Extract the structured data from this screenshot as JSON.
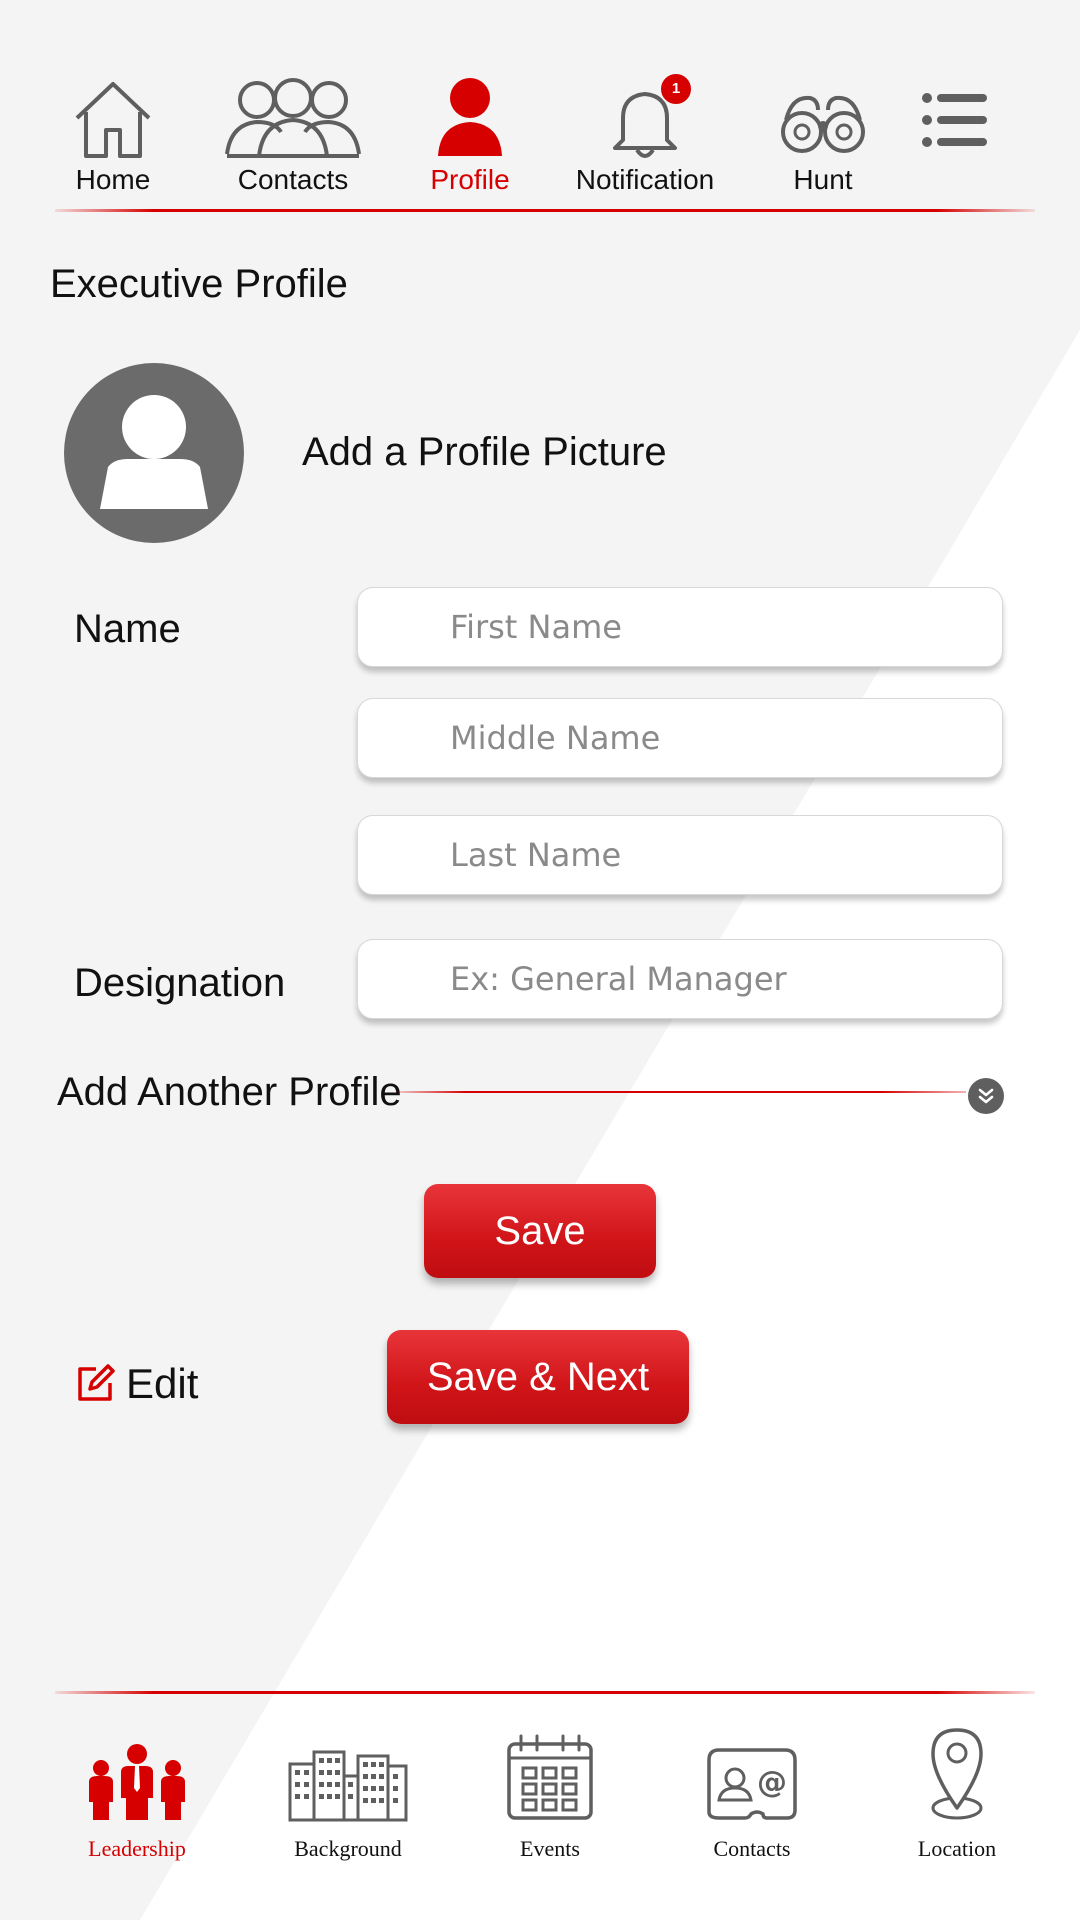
{
  "top_nav": {
    "items": [
      {
        "label": "Home",
        "icon": "home-icon"
      },
      {
        "label": "Contacts",
        "icon": "contacts-icon"
      },
      {
        "label": "Profile",
        "icon": "profile-icon",
        "active": true
      },
      {
        "label": "Notification",
        "icon": "bell-icon",
        "badge": "1"
      },
      {
        "label": "Hunt",
        "icon": "binoculars-icon"
      },
      {
        "label": "",
        "icon": "menu-icon"
      }
    ]
  },
  "page": {
    "title": "Executive Profile",
    "add_picture_label": "Add a Profile Picture"
  },
  "form": {
    "name_label": "Name",
    "first_name_placeholder": "First Name",
    "middle_name_placeholder": "Middle Name",
    "last_name_placeholder": "Last Name",
    "designation_label": "Designation",
    "designation_placeholder": "Ex: General Manager",
    "add_another_label": "Add Another Profile"
  },
  "actions": {
    "save_label": "Save",
    "save_next_label": "Save & Next",
    "edit_label": "Edit"
  },
  "bottom_nav": {
    "items": [
      {
        "label": "Leadership",
        "icon": "leadership-icon",
        "active": true
      },
      {
        "label": "Background",
        "icon": "buildings-icon"
      },
      {
        "label": "Events",
        "icon": "calendar-icon"
      },
      {
        "label": "Contacts",
        "icon": "contact-card-icon"
      },
      {
        "label": "Location",
        "icon": "location-pin-icon"
      }
    ]
  },
  "colors": {
    "accent": "#d60000",
    "icon_gray": "#5f5f5f",
    "background": "#f4f4f4"
  }
}
